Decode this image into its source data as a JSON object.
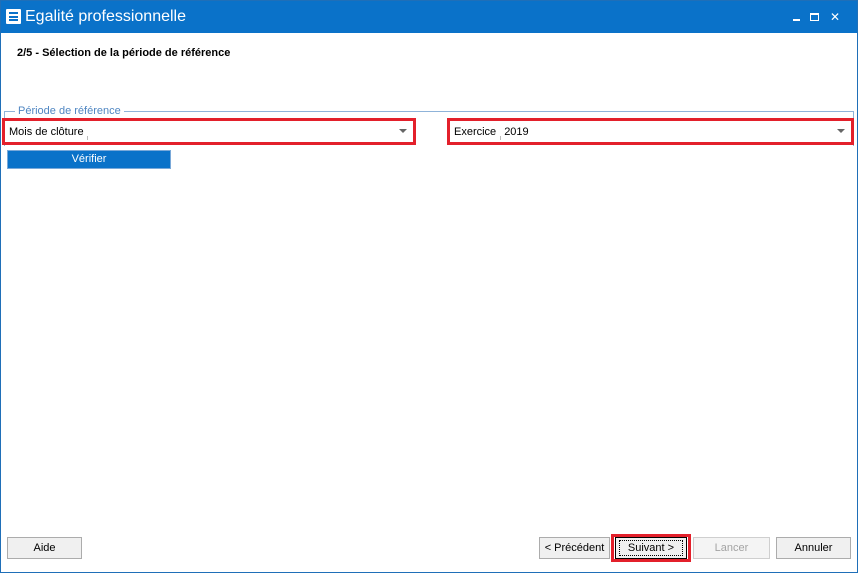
{
  "window": {
    "title": "Egalité professionnelle",
    "controls": {
      "minimize": "minimize-icon",
      "maximize": "maximize-icon",
      "close": "✕"
    },
    "colors": {
      "titlebar": "#0a72c9",
      "highlight": "#e3202b"
    }
  },
  "step": {
    "title": "2/5 - Sélection de la période de référence"
  },
  "reference_period": {
    "legend": "Période de référence",
    "month_combo": {
      "label": "Mois de clôture",
      "value": ""
    },
    "year_combo": {
      "label": "Exercice",
      "value": "2019"
    },
    "verify_label": "Vérifier"
  },
  "footer": {
    "help_label": "Aide",
    "previous_label": "< Précédent",
    "next_label": "Suivant >",
    "launch_label": "Lancer",
    "cancel_label": "Annuler"
  }
}
